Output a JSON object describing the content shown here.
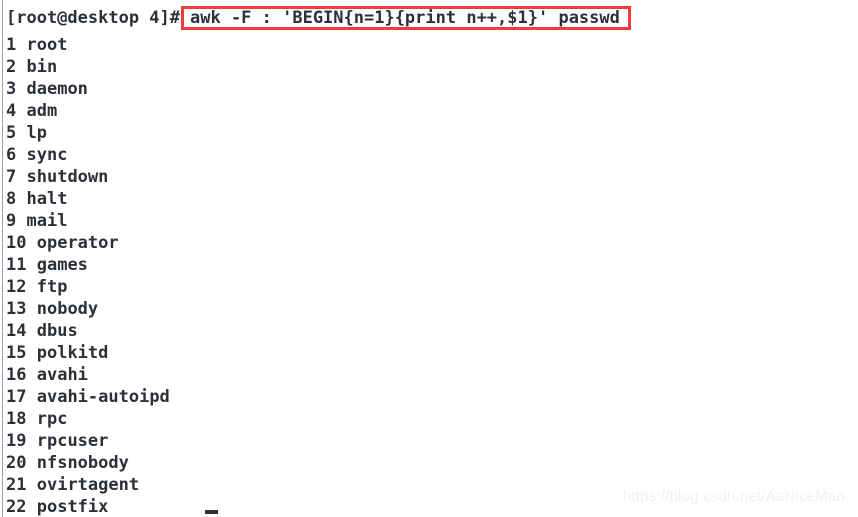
{
  "terminal": {
    "prompt": "[root@desktop 4]#",
    "command": "awk -F : 'BEGIN{n=1}{print n++,$1}' passwd",
    "highlight_color": "#ef3b3b",
    "text_color": "#2b3137",
    "background_color": "#ffffff",
    "cursor_glyph": "_",
    "output_lines": [
      {
        "number": "1",
        "name": "root"
      },
      {
        "number": "2",
        "name": "bin"
      },
      {
        "number": "3",
        "name": "daemon"
      },
      {
        "number": "4",
        "name": "adm"
      },
      {
        "number": "5",
        "name": "lp"
      },
      {
        "number": "6",
        "name": "sync"
      },
      {
        "number": "7",
        "name": "shutdown"
      },
      {
        "number": "8",
        "name": "halt"
      },
      {
        "number": "9",
        "name": "mail"
      },
      {
        "number": "10",
        "name": "operator"
      },
      {
        "number": "11",
        "name": "games"
      },
      {
        "number": "12",
        "name": "ftp"
      },
      {
        "number": "13",
        "name": "nobody"
      },
      {
        "number": "14",
        "name": "dbus"
      },
      {
        "number": "15",
        "name": "polkitd"
      },
      {
        "number": "16",
        "name": "avahi"
      },
      {
        "number": "17",
        "name": "avahi-autoipd"
      },
      {
        "number": "18",
        "name": "rpc"
      },
      {
        "number": "19",
        "name": "rpcuser"
      },
      {
        "number": "20",
        "name": "nfsnobody"
      },
      {
        "number": "21",
        "name": "ovirtagent"
      },
      {
        "number": "22",
        "name": "postfix"
      }
    ]
  },
  "watermark": {
    "text": "https://blog.csdn.net/AaNiceMan",
    "color": "#f0f0f0"
  }
}
